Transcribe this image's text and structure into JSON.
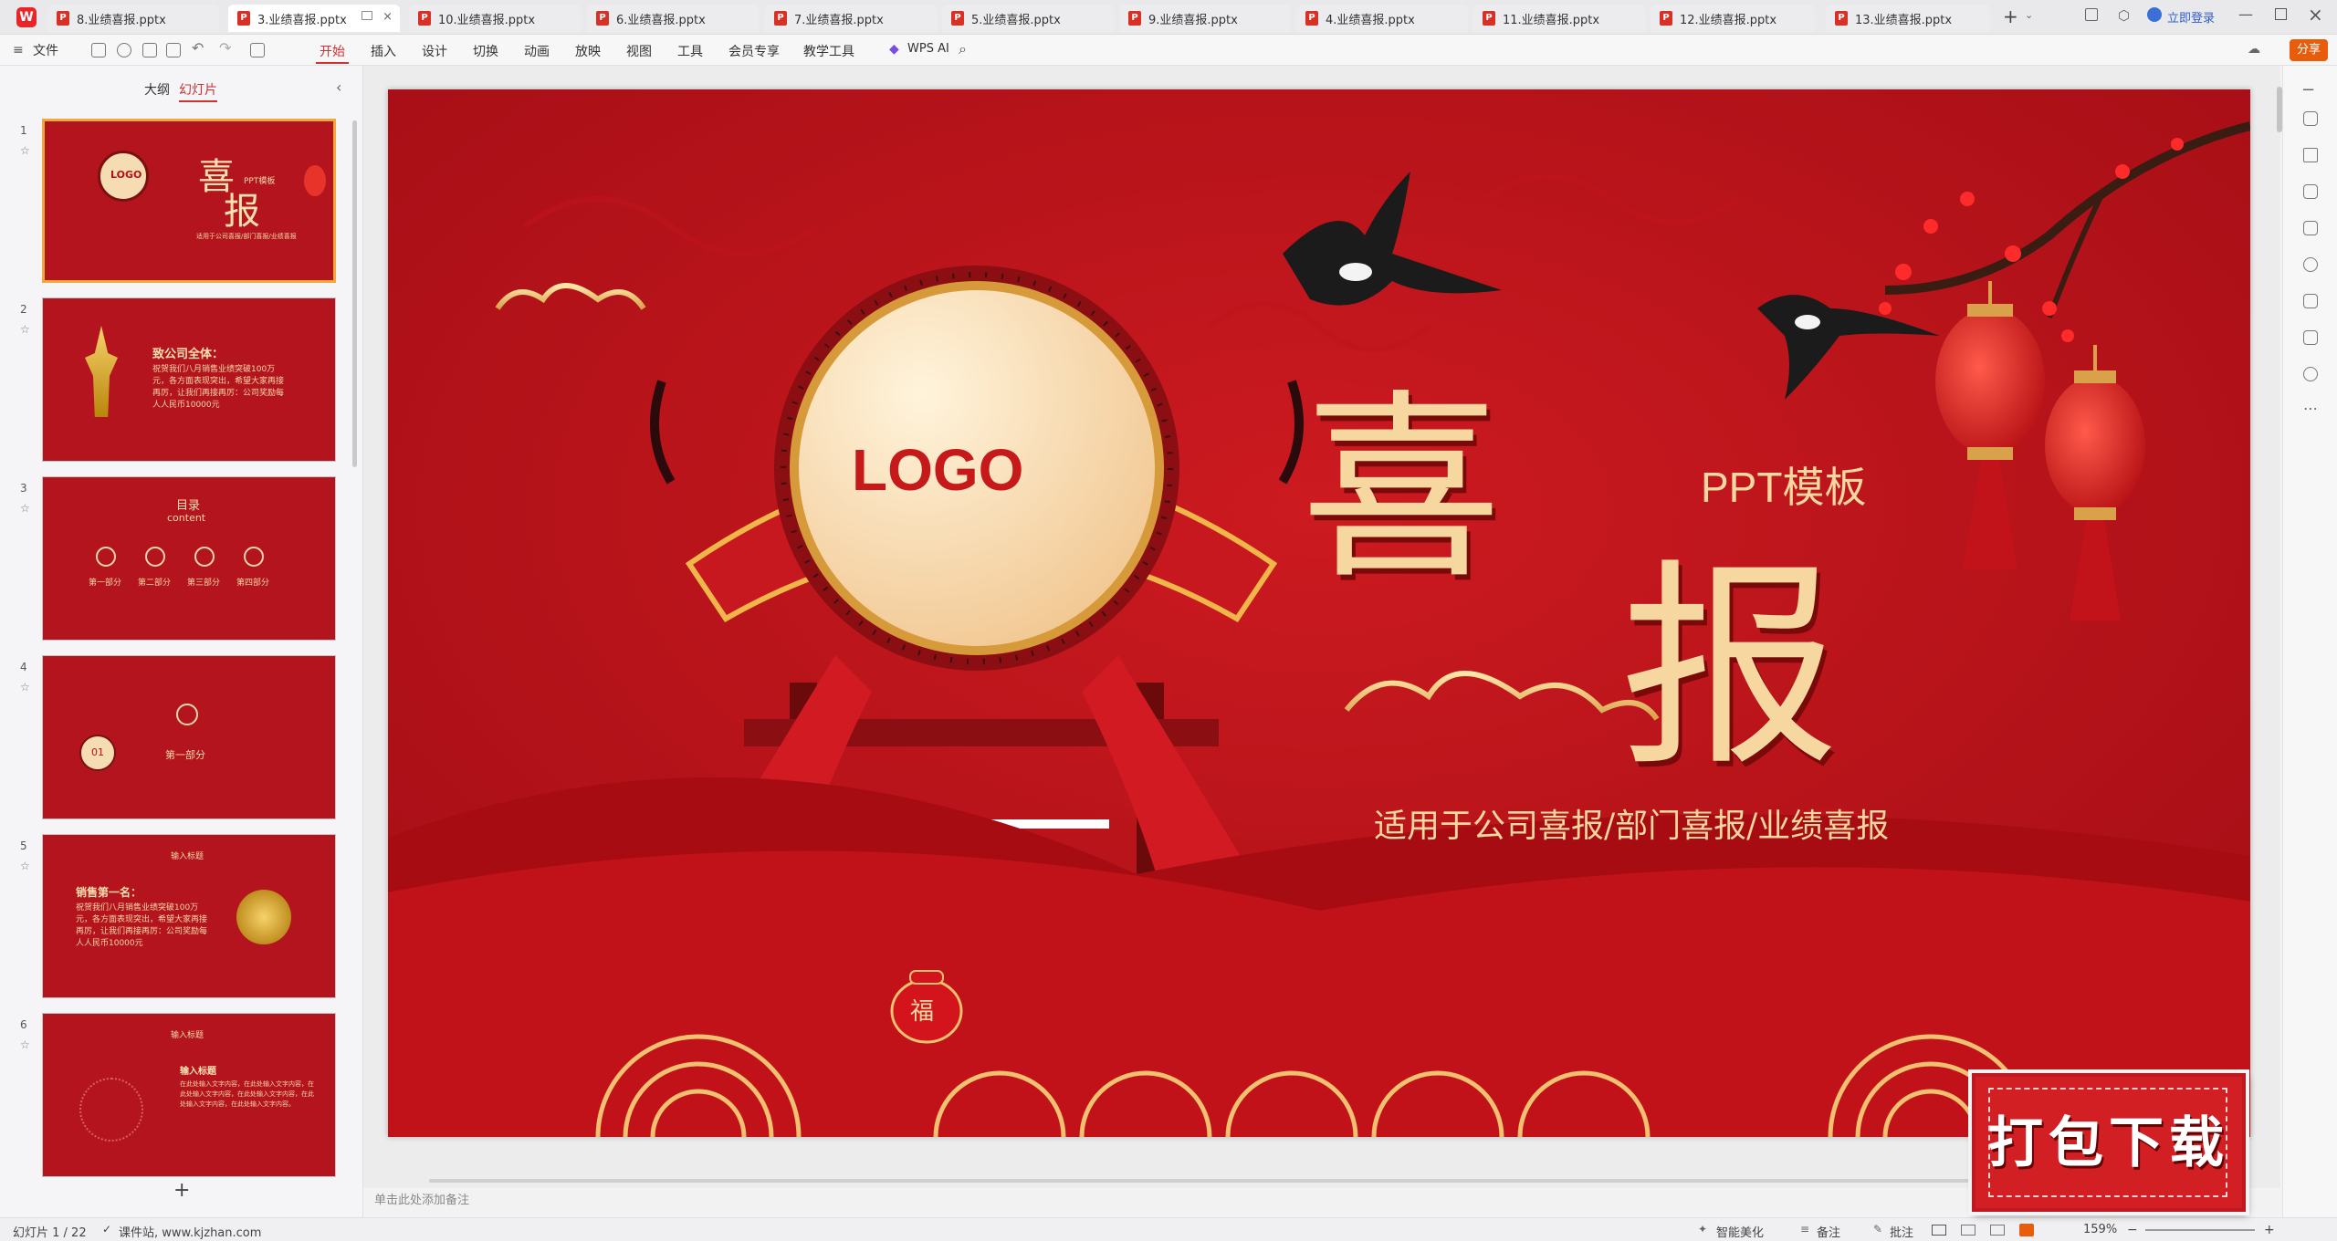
{
  "tabs": [
    {
      "label": "8.业绩喜报.pptx",
      "active": false
    },
    {
      "label": "3.业绩喜报.pptx",
      "active": true
    },
    {
      "label": "10.业绩喜报.pptx",
      "active": false
    },
    {
      "label": "6.业绩喜报.pptx",
      "active": false
    },
    {
      "label": "7.业绩喜报.pptx",
      "active": false
    },
    {
      "label": "5.业绩喜报.pptx",
      "active": false
    },
    {
      "label": "9.业绩喜报.pptx",
      "active": false
    },
    {
      "label": "4.业绩喜报.pptx",
      "active": false
    },
    {
      "label": "11.业绩喜报.pptx",
      "active": false
    },
    {
      "label": "12.业绩喜报.pptx",
      "active": false
    },
    {
      "label": "13.业绩喜报.pptx",
      "active": false
    }
  ],
  "account": {
    "login_label": "立即登录",
    "share_label": "分享"
  },
  "toolbar": {
    "file_label": "文件",
    "menus": [
      "开始",
      "插入",
      "设计",
      "切换",
      "动画",
      "放映",
      "视图",
      "工具",
      "会员专享",
      "教学工具"
    ],
    "active_menu": "开始",
    "wps_ai": "WPS AI"
  },
  "left_panel": {
    "outline_tab": "大纲",
    "slides_tab": "幻灯片"
  },
  "thumbs": {
    "t1": {
      "num": "1",
      "logo": "LOGO",
      "title_a": "喜",
      "title_b": "报",
      "tag": "PPT模板",
      "sub": "适用于公司喜报/部门喜报/业绩喜报"
    },
    "t2": {
      "num": "2",
      "title": "致公司全体：",
      "body": "祝贺我们八月销售业绩突破100万元，各方面表现突出，希望大家再接再厉，让我们再接再厉：公司奖励每人人民币10000元"
    },
    "t3": {
      "num": "3",
      "title": "目录",
      "sub": "content",
      "parts": [
        "第一部分",
        "第二部分",
        "第三部分",
        "第四部分"
      ]
    },
    "t4": {
      "num": "4",
      "badge": "01",
      "title": "第一部分"
    },
    "t5": {
      "num": "5",
      "head": "输入标题",
      "title": "销售第一名：",
      "body": "祝贺我们八月销售业绩突破100万元，各方面表现突出，希望大家再接再厉，让我们再接再厉：公司奖励每人人民币10000元"
    },
    "t6": {
      "num": "6",
      "head": "输入标题",
      "title": "输入标题",
      "body": "在此处输入文字内容，在此处输入文字内容，在此处输入文字内容，在此处输入文字内容，在此处输入文字内容，在此处输入文字内容。"
    }
  },
  "slide": {
    "logo": "LOGO",
    "title_char1": "喜",
    "title_char2": "报",
    "tag": "PPT模板",
    "subtitle": "适用于公司喜报/部门喜报/业绩喜报",
    "fu": "福"
  },
  "notes_placeholder": "单击此处添加备注",
  "download_badge": "打包下载",
  "status": {
    "slide_count": "幻灯片 1 / 22",
    "source": "课件站, www.kjzhan.com",
    "smart": "智能美化",
    "notes": "备注",
    "comment": "批注",
    "zoom": "159%"
  },
  "colors": {
    "slide_bg": "#b40f17",
    "gold": "#f6d7a0",
    "accent": "#c33"
  }
}
